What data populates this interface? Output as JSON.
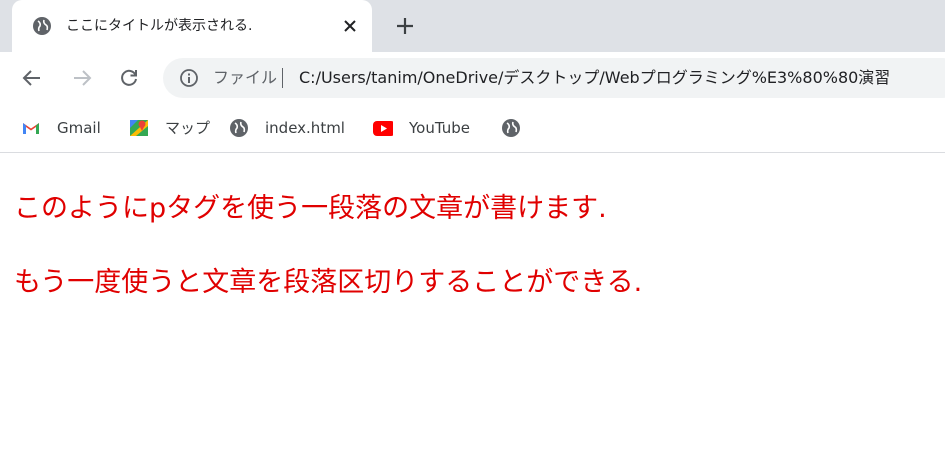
{
  "tab": {
    "title": "ここにタイトルが表示される."
  },
  "toolbar": {
    "scheme_label": "ファイル",
    "url": "C:/Users/tanim/OneDrive/デスクトップ/Webプログラミング%E3%80%80演習"
  },
  "bookmarks": [
    {
      "label": "Gmail",
      "icon": "gmail-icon"
    },
    {
      "label": "マップ",
      "icon": "maps-icon"
    },
    {
      "label": "index.html",
      "icon": "globe-icon"
    },
    {
      "label": "YouTube",
      "icon": "youtube-icon"
    },
    {
      "label": "",
      "icon": "globe-icon"
    }
  ],
  "content": {
    "paragraphs": [
      "このようにpタグを使う一段落の文章が書けます.",
      "もう一度使うと文章を段落区切りすることができる."
    ],
    "text_color": "#e00000"
  }
}
